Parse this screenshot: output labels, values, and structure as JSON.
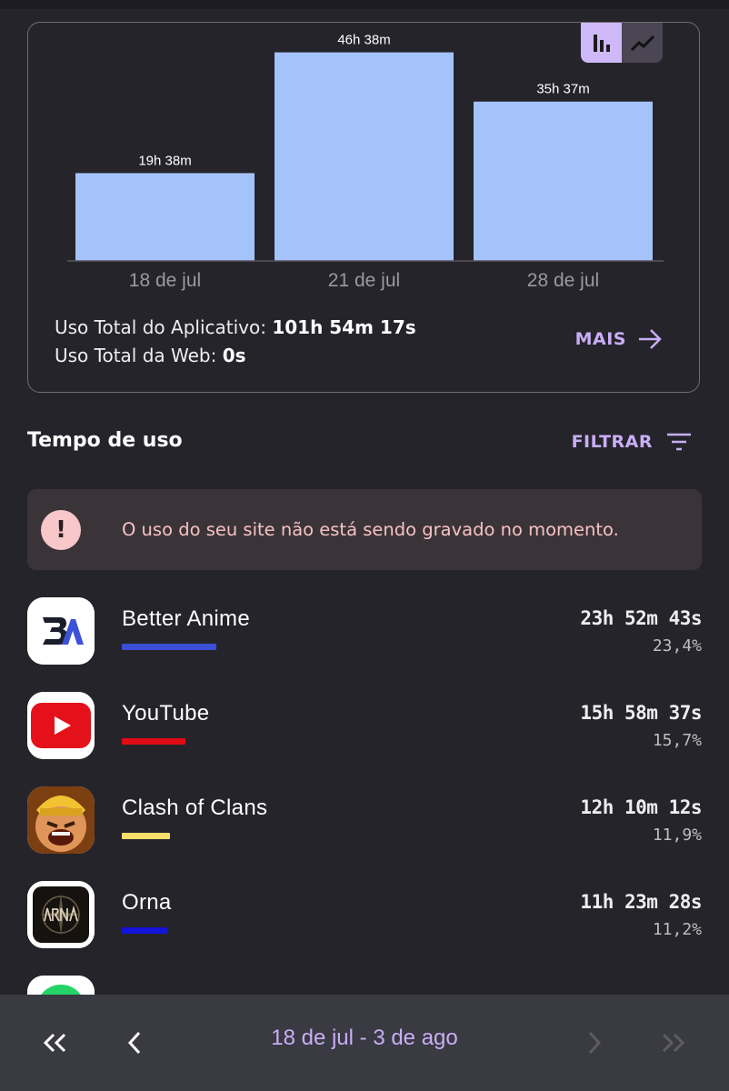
{
  "chart_card": {
    "toggle": {
      "bar_icon": "bar-chart-icon",
      "line_icon": "line-chart-icon",
      "selected": "bar"
    },
    "totals": {
      "app_label": "Uso Total do Aplicativo:",
      "app_value": "101h 54m 17s",
      "web_label": "Uso Total da Web:",
      "web_value": "0s"
    },
    "more_label": "MAIS"
  },
  "chart_data": {
    "type": "bar",
    "categories": [
      "18 de jul",
      "21 de jul",
      "28 de jul"
    ],
    "values": [
      19.63,
      46.63,
      35.62
    ],
    "value_labels": [
      "19h 38m",
      "46h 38m",
      "35h 37m"
    ],
    "ylim": [
      0,
      50
    ],
    "bar_color": "#a5c3fb"
  },
  "section": {
    "title": "Tempo de uso",
    "filter_label": "FILTRAR"
  },
  "warning": {
    "text": "O uso do seu site não está sendo gravado no momento.",
    "icon": "exclamation-icon"
  },
  "apps": [
    {
      "name": "Better Anime",
      "time": "23h 52m 43s",
      "percent": "23,4%",
      "color": "#3a4fd6",
      "share": 0.234,
      "icon": "better-anime-icon"
    },
    {
      "name": "YouTube",
      "time": "15h 58m 37s",
      "percent": "15,7%",
      "color": "#e10b16",
      "share": 0.157,
      "icon": "youtube-icon"
    },
    {
      "name": "Clash of Clans",
      "time": "12h 10m 12s",
      "percent": "11,9%",
      "color": "#f6de6b",
      "share": 0.119,
      "icon": "clash-of-clans-icon"
    },
    {
      "name": "Orna",
      "time": "11h 23m 28s",
      "percent": "11,2%",
      "color": "#1313d9",
      "share": 0.112,
      "icon": "orna-icon"
    }
  ],
  "bottom_nav": {
    "range": "18 de jul - 3 de ago"
  }
}
